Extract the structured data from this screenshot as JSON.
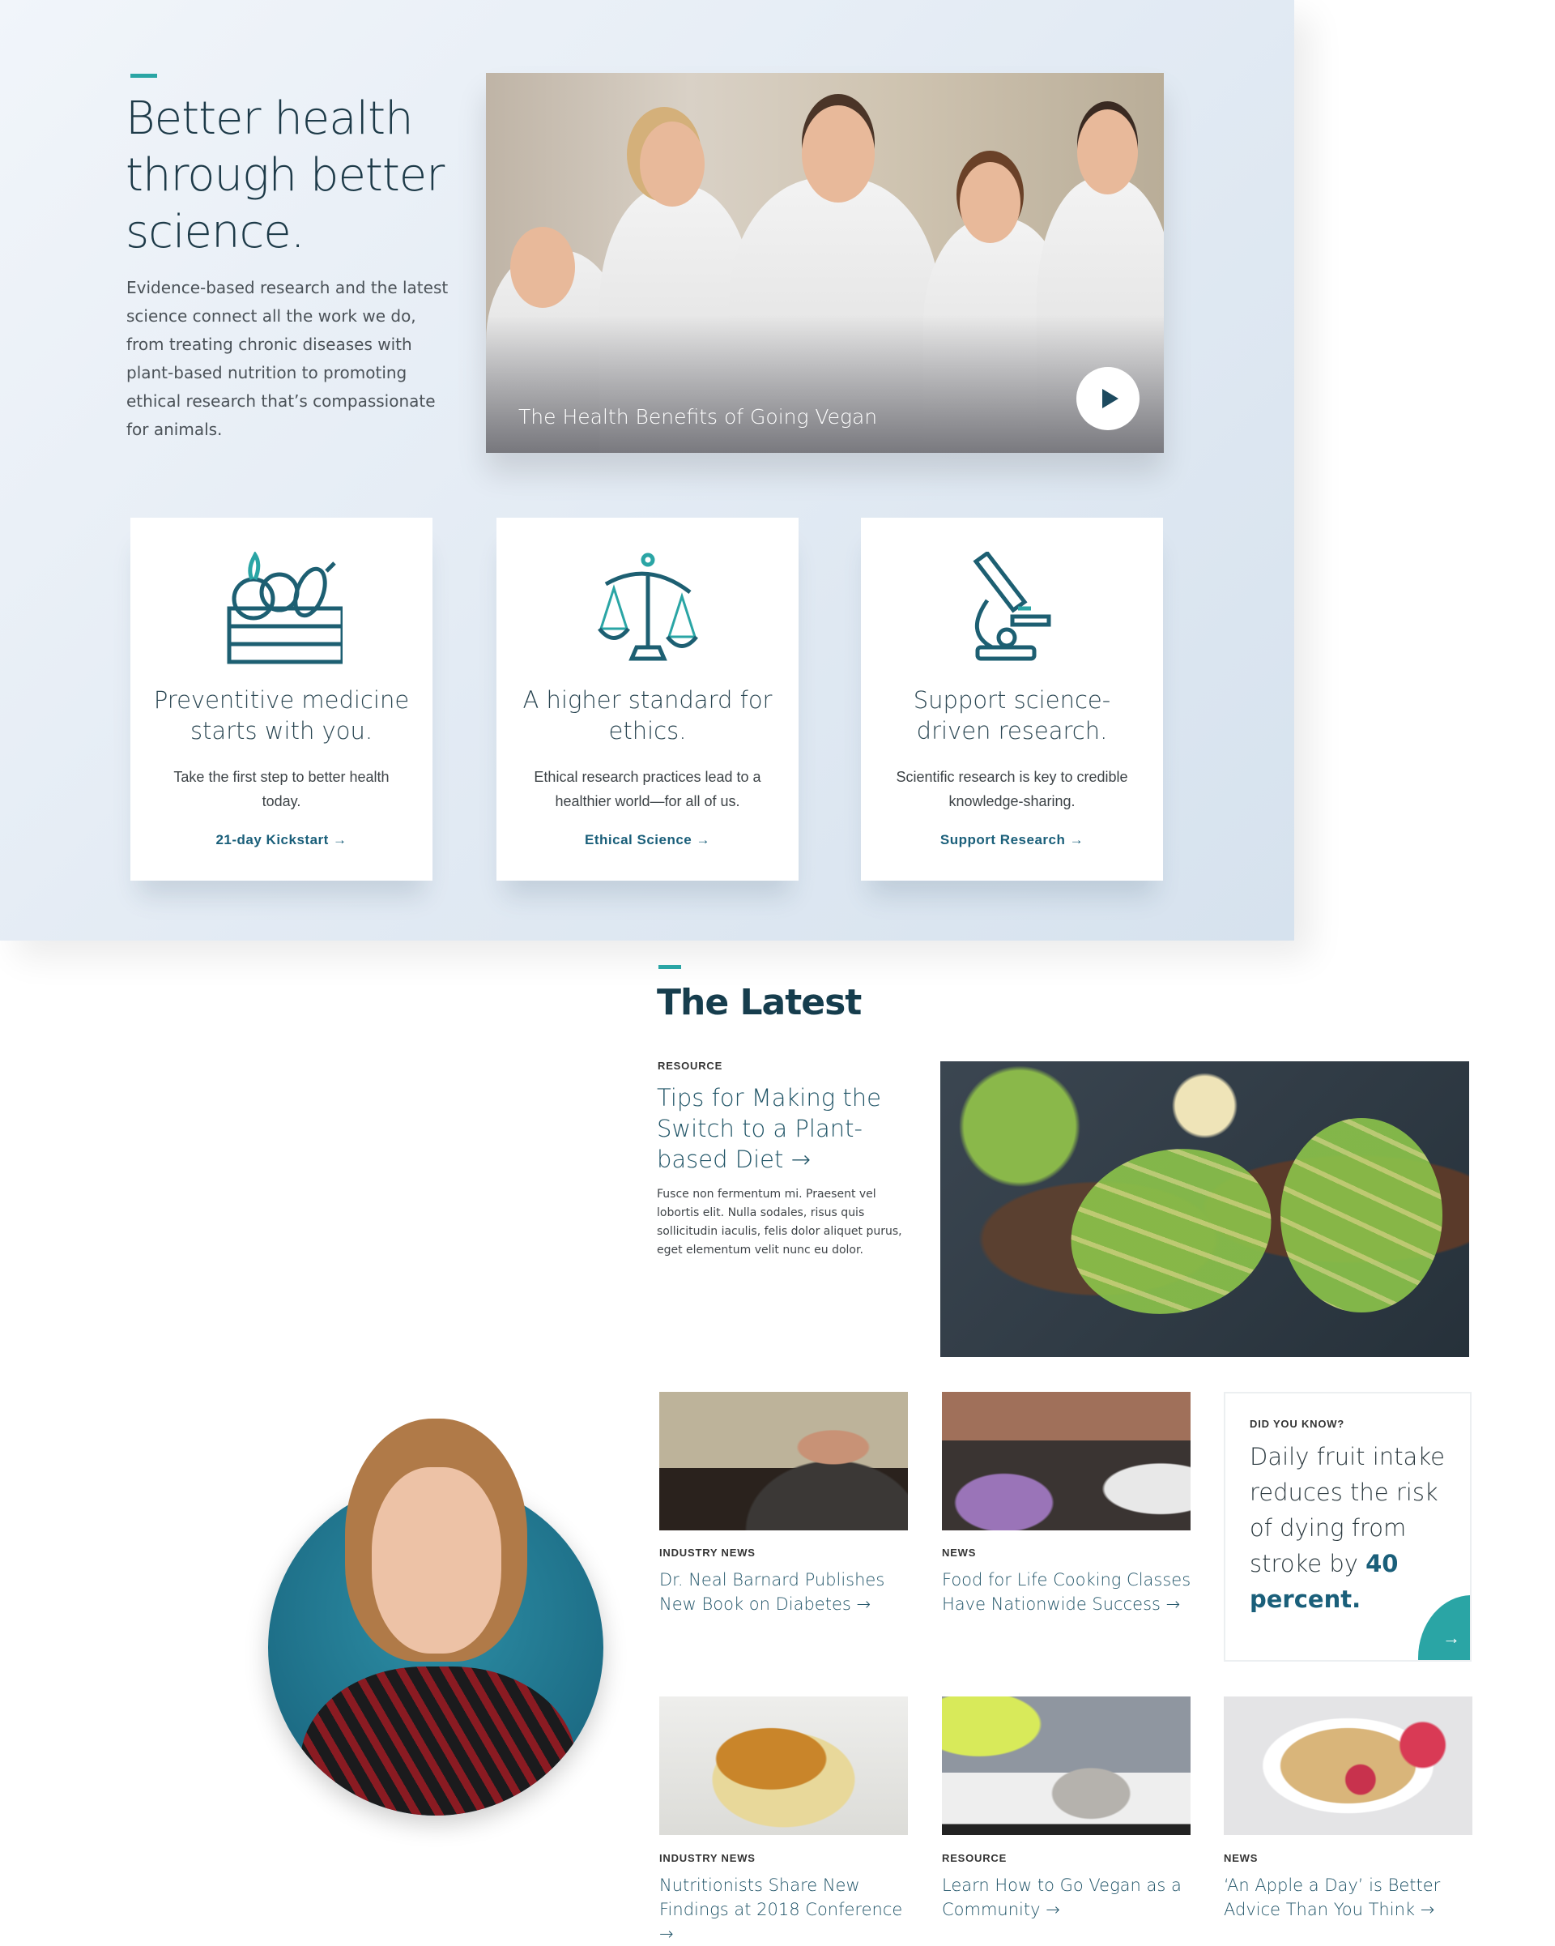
{
  "hero": {
    "title": "Better health through better science.",
    "text": "Evidence-based research and the latest science connect all the work we do, from treating chronic diseases with plant-based nutrition to promoting ethical research that’s compassionate for animals.",
    "video_caption": "The Health Benefits of Going Vegan",
    "play_icon": "play-icon"
  },
  "cards": [
    {
      "icon": "vegetable-crate-icon",
      "title": "Preventitive medicine starts with you.",
      "desc": "Take the first step to better health today.",
      "link": "21-day Kickstart →"
    },
    {
      "icon": "scales-of-justice-icon",
      "title": "A higher standard for ethics.",
      "desc": "Ethical research practices lead to a healthier world—for all of us.",
      "link": "Ethical Science →"
    },
    {
      "icon": "microscope-icon",
      "title": "Support science-driven research.",
      "desc": "Scientific research is key to credible knowledge-sharing.",
      "link": "Support Research →"
    }
  ],
  "latest": {
    "heading": "The Latest",
    "featured": {
      "label": "RESOURCE",
      "title": "Tips for Making the Switch to a Plant-based Diet →",
      "desc": "Fusce non fermentum mi. Praesent vel lobortis elit. Nulla sodales, risus quis sollicitudin iaculis, felis dolor aliquet purus, eget elementum velit nunc eu dolor."
    },
    "items": [
      {
        "label": "INDUSTRY NEWS",
        "title": "Dr. Neal Barnard Publishes New Book on Diabetes →"
      },
      {
        "label": "NEWS",
        "title": "Food for Life Cooking Classes Have Nationwide Success →"
      },
      {
        "label": "INDUSTRY NEWS",
        "title": "Nutritionists Share New Findings at 2018 Conference →"
      },
      {
        "label": "RESOURCE",
        "title": "Learn How to Go Vegan as a Community →"
      },
      {
        "label": "NEWS",
        "title": "‘An Apple a Day’ is Better Advice Than You Think →"
      }
    ],
    "did_you_know": {
      "label": "DID YOU KNOW?",
      "text": "Daily fruit intake reduces the risk of dying from stroke by ",
      "highlight": "40 percent.",
      "arrow": "→"
    }
  },
  "colors": {
    "accent": "#2aa5a5",
    "link": "#1a5f7a",
    "heading": "#163d4d"
  }
}
